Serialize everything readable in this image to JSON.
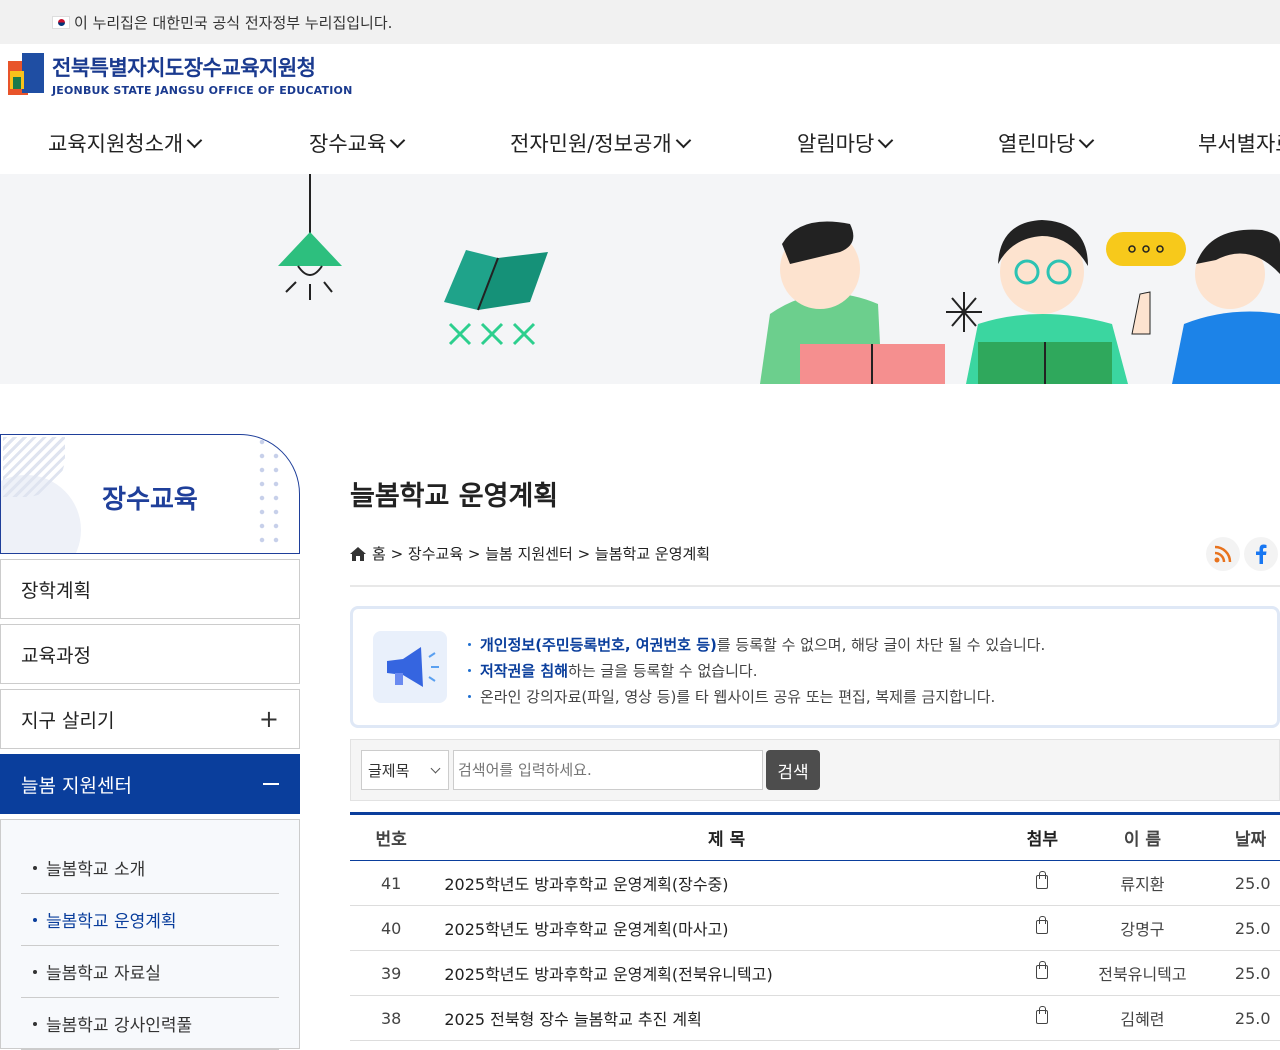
{
  "gov_notice": "이 누리집은 대한민국 공식 전자정부 누리집입니다.",
  "logo": {
    "korean": "전북특별자치도장수교육지원청",
    "english": "JEONBUK STATE JANGSU OFFICE OF EDUCATION"
  },
  "gnb": [
    "교육지원청소개",
    "장수교육",
    "전자민원/정보공개",
    "알림마당",
    "열린마당",
    "부서별자료"
  ],
  "side": {
    "title": "장수교육",
    "items": [
      "장학계획",
      "교육과정",
      "지구 살리기",
      "늘봄 지원센터"
    ],
    "sub_items": [
      "늘봄학교 소개",
      "늘봄학교 운영계획",
      "늘봄학교 자료실",
      "늘봄학교 강사인력풀"
    ]
  },
  "page": {
    "title": "늘봄학교 운영계획",
    "breadcrumb": [
      "홈",
      "장수교육",
      "늘봄 지원센터",
      "늘봄학교 운영계획"
    ]
  },
  "notice": {
    "line1_strong": "개인정보(주민등록번호, 여권번호 등)",
    "line1_rest": "를 등록할 수 없으며, 해당 글이 차단 될 수 있습니다.",
    "line2_strong": "저작권을 침해",
    "line2_rest": "하는 글을 등록할 수 없습니다.",
    "line3": "온라인 강의자료(파일, 영상 등)를 타 웹사이트 공유 또는 편집, 복제를 금지합니다."
  },
  "search": {
    "select": "글제목",
    "placeholder": "검색어를 입력하세요.",
    "button": "검색"
  },
  "table": {
    "headers": {
      "no": "번호",
      "title": "제 목",
      "attach": "첨부",
      "name": "이 름",
      "date": "날짜"
    },
    "rows": [
      {
        "no": "41",
        "title": "2025학년도 방과후학교 운영계획(장수중)",
        "name": "류지환",
        "date": "25.0"
      },
      {
        "no": "40",
        "title": "2025학년도 방과후학교 운영계획(마사고)",
        "name": "강명구",
        "date": "25.0"
      },
      {
        "no": "39",
        "title": "2025학년도 방과후학교 운영계획(전북유니텍고)",
        "name": "전북유니텍고",
        "date": "25.0"
      },
      {
        "no": "38",
        "title": "2025 전북형 장수 늘봄학교 추진 계획",
        "name": "김혜련",
        "date": "25.0"
      }
    ]
  }
}
